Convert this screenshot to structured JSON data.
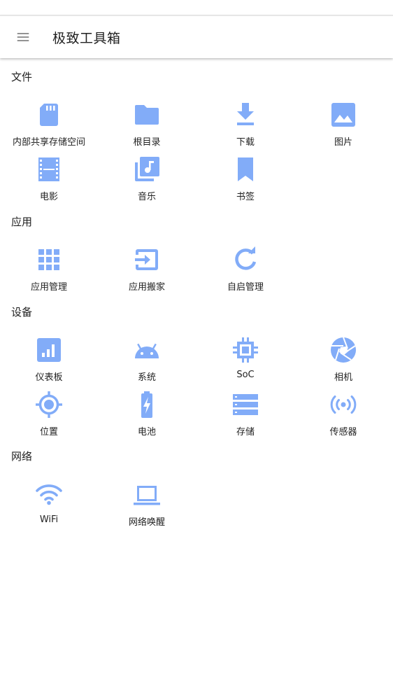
{
  "app": {
    "title": "极致工具箱",
    "accent_color": "#82acf8"
  },
  "sections": [
    {
      "title": "文件",
      "items": [
        {
          "label": "内部共享存储空间",
          "icon": "sd-card-icon"
        },
        {
          "label": "根目录",
          "icon": "folder-icon"
        },
        {
          "label": "下载",
          "icon": "download-icon"
        },
        {
          "label": "图片",
          "icon": "image-icon"
        },
        {
          "label": "电影",
          "icon": "movie-icon"
        },
        {
          "label": "音乐",
          "icon": "music-library-icon"
        },
        {
          "label": "书签",
          "icon": "bookmark-icon"
        }
      ]
    },
    {
      "title": "应用",
      "items": [
        {
          "label": "应用管理",
          "icon": "apps-grid-icon"
        },
        {
          "label": "应用搬家",
          "icon": "exit-to-app-icon"
        },
        {
          "label": "自启管理",
          "icon": "refresh-icon"
        }
      ]
    },
    {
      "title": "设备",
      "items": [
        {
          "label": "仪表板",
          "icon": "dashboard-icon"
        },
        {
          "label": "系统",
          "icon": "android-icon"
        },
        {
          "label": "SoC",
          "icon": "chip-icon"
        },
        {
          "label": "相机",
          "icon": "camera-aperture-icon"
        },
        {
          "label": "位置",
          "icon": "gps-location-icon"
        },
        {
          "label": "电池",
          "icon": "battery-charging-icon"
        },
        {
          "label": "存储",
          "icon": "storage-icon"
        },
        {
          "label": "传感器",
          "icon": "sensor-icon"
        }
      ]
    },
    {
      "title": "网络",
      "items": [
        {
          "label": "WiFi",
          "icon": "wifi-icon"
        },
        {
          "label": "网络唤醒",
          "icon": "laptop-icon"
        }
      ]
    }
  ]
}
